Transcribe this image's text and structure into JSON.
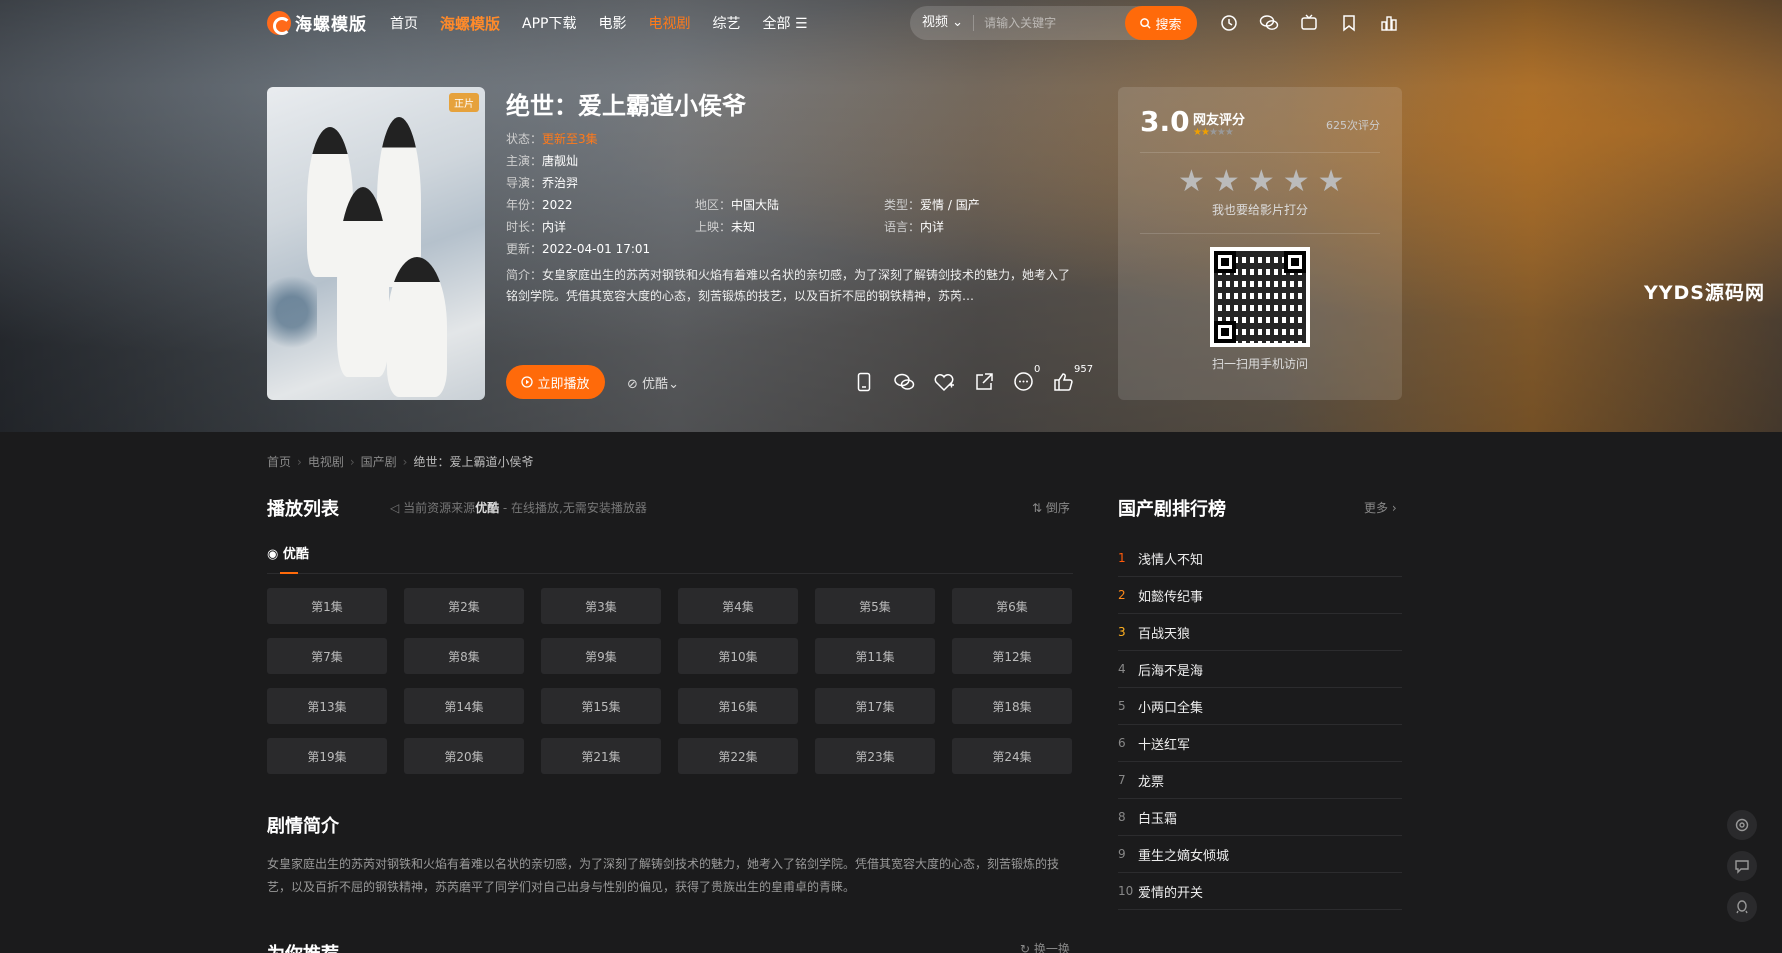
{
  "nav": {
    "logo": "海螺模版",
    "links": [
      "首页",
      "海螺模版",
      "APP下载",
      "电影",
      "电视剧",
      "综艺",
      "全部"
    ],
    "search_category": "视频",
    "search_placeholder": "请输入关键字",
    "search_button": "搜索",
    "icons": [
      "history-icon",
      "wechat-icon",
      "tv-icon",
      "bookmark-icon",
      "chart-icon"
    ]
  },
  "detail": {
    "badge": "正片",
    "title": "绝世：爱上霸道小侯爷",
    "status_label": "状态：",
    "status_value": "更新至3集",
    "cast_label": "主演：",
    "cast_value": "唐靓灿",
    "director_label": "导演：",
    "director_value": "乔治羿",
    "year_label": "年份：",
    "year_value": "2022",
    "region_label": "地区：",
    "region_value": "中国大陆",
    "genre_label": "类型：",
    "genre_value": "爱情 / 国产",
    "duration_label": "时长：",
    "duration_value": "内详",
    "release_label": "上映：",
    "release_value": "未知",
    "language_label": "语言：",
    "language_value": "内详",
    "updated_label": "更新：",
    "updated_value": "2022-04-01 17:01",
    "synopsis_label": "简介：",
    "synopsis_value": "女皇家庭出生的苏芮对钢铁和火焰有着难以名状的亲切感，为了深刻了解铸剑技术的魅力，她考入了铭剑学院。凭借其宽容大度的心态，刻苦锻炼的技艺，以及百折不屈的钢铁精神，苏芮…",
    "play_button": "立即播放",
    "source": "优酷",
    "comment_count": "0",
    "like_count": "957"
  },
  "rating": {
    "score": "3.0",
    "label": "网友评分",
    "stars_filled": 1.5,
    "stars_total": 5,
    "count": "625次评分",
    "rate_hint": "我也要给影片打分",
    "qr_text": "扫一扫用手机访问"
  },
  "watermark": "YYDS源码网",
  "breadcrumb": [
    "首页",
    "电视剧",
    "国产剧",
    "绝世：爱上霸道小侯爷"
  ],
  "playlist": {
    "title": "播放列表",
    "note_prefix": "当前资源来源",
    "note_source": "优酷",
    "note_suffix": " - 在线播放,无需安装播放器",
    "sort": "倒序",
    "tab": "优酷",
    "episodes": [
      "第1集",
      "第2集",
      "第3集",
      "第4集",
      "第5集",
      "第6集",
      "第7集",
      "第8集",
      "第9集",
      "第10集",
      "第11集",
      "第12集",
      "第13集",
      "第14集",
      "第15集",
      "第16集",
      "第17集",
      "第18集",
      "第19集",
      "第20集",
      "第21集",
      "第22集",
      "第23集",
      "第24集"
    ]
  },
  "plot": {
    "title": "剧情简介",
    "text": "女皇家庭出生的苏芮对钢铁和火焰有着难以名状的亲切感，为了深刻了解铸剑技术的魅力，她考入了铭剑学院。凭借其宽容大度的心态，刻苦锻炼的技艺，以及百折不屈的钢铁精神，苏芮磨平了同学们对自己出身与性别的偏见，获得了贵族出生的皇甫卓的青睐。"
  },
  "recommend": {
    "title": "为你推荐",
    "refresh": "换一换"
  },
  "ranking": {
    "title": "国产剧排行榜",
    "more": "更多",
    "items": [
      "浅情人不知",
      "如懿传纪事",
      "百战天狼",
      "后海不是海",
      "小两口全集",
      "十送红军",
      "龙票",
      "白玉霜",
      "重生之嫡女倾城",
      "爱情的开关"
    ]
  },
  "colors": {
    "accent": "#ff6a0a",
    "background": "#1b1b1c"
  },
  "floating_tools": [
    "settings-icon",
    "comment-icon",
    "qq-icon"
  ]
}
